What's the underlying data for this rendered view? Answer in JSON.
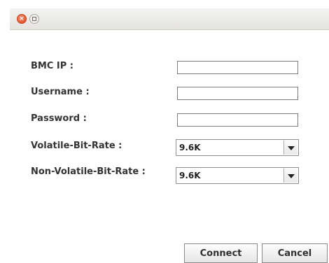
{
  "window": {
    "close_glyph": "×"
  },
  "form": {
    "bmc_ip_label": "BMC IP :",
    "bmc_ip_value": "",
    "username_label": "Username :",
    "username_value": "",
    "password_label": "Password :",
    "password_value": "",
    "volatile_label": "Volatile-Bit-Rate :",
    "volatile_value": "9.6K",
    "nonvolatile_label": "Non-Volatile-Bit-Rate :",
    "nonvolatile_value": "9.6K"
  },
  "buttons": {
    "connect_label": "Connect",
    "cancel_label": "Cancel"
  },
  "icons": {
    "close": "close-icon",
    "maximize": "maximize-icon",
    "dropdown": "chevron-down-icon"
  }
}
